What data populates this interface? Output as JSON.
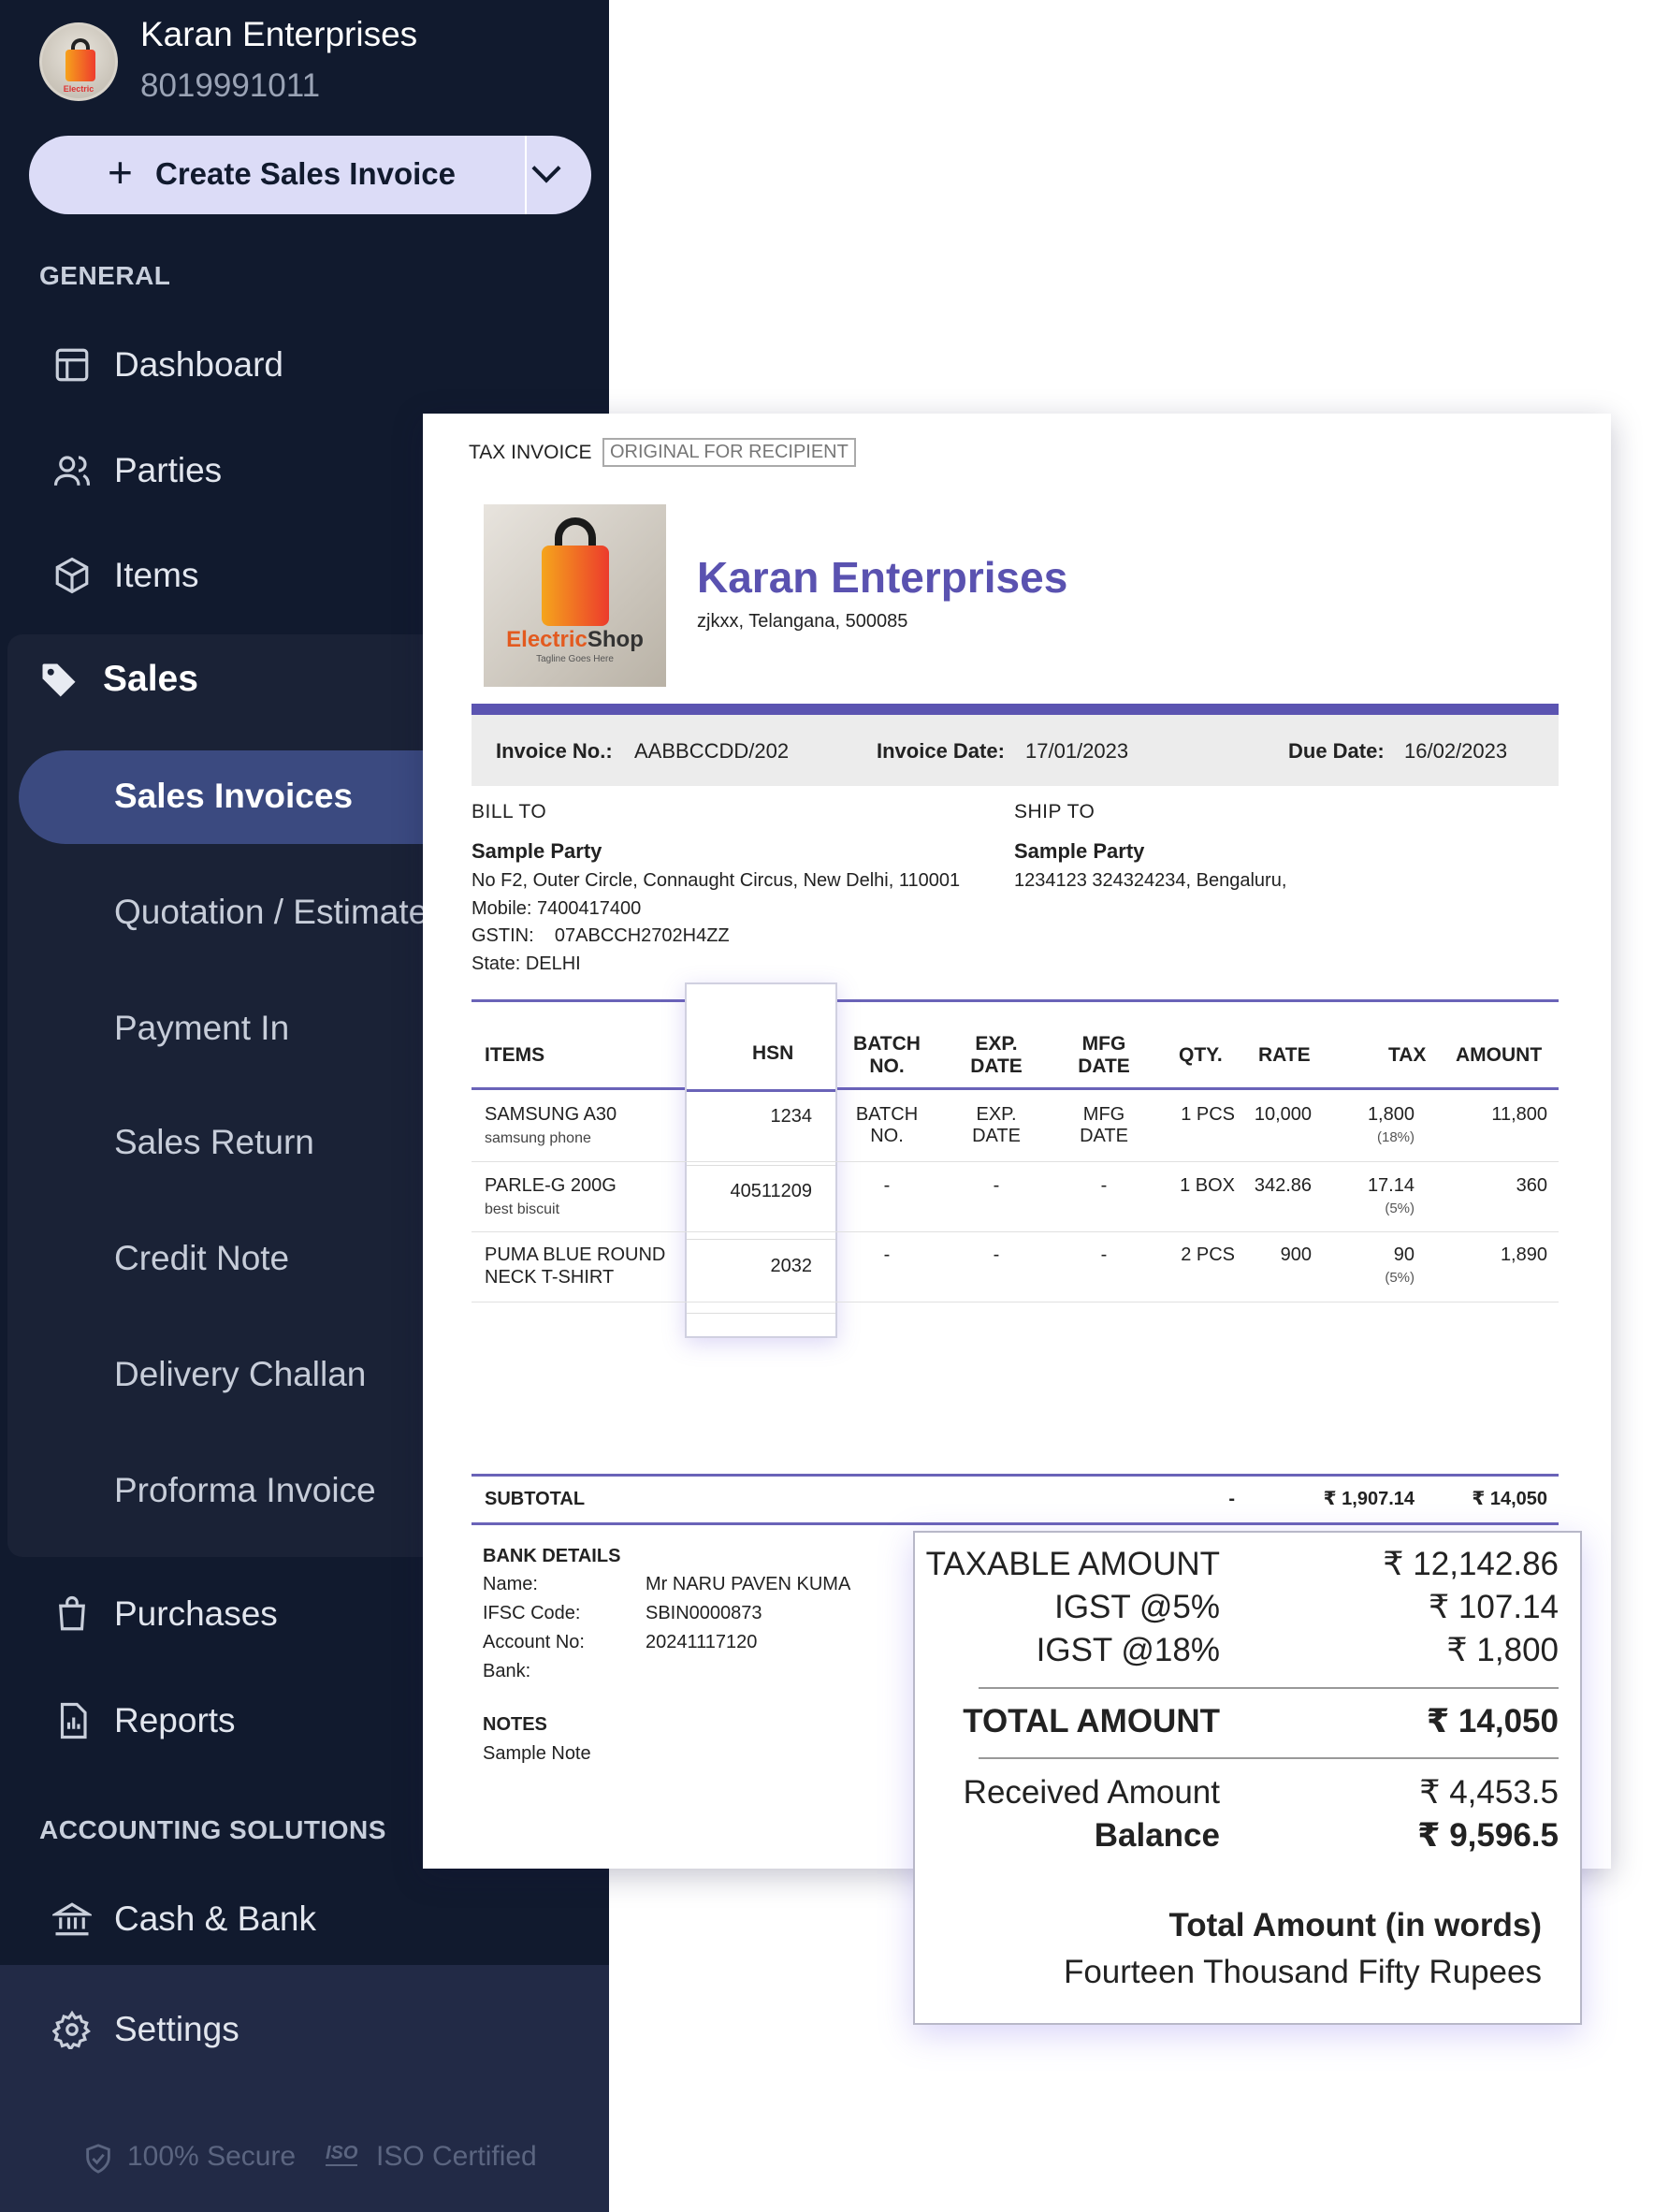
{
  "business": {
    "name": "Karan Enterprises",
    "phone": "8019991011"
  },
  "create_button": {
    "label": "Create Sales Invoice"
  },
  "sections": {
    "general": "GENERAL",
    "accounting": "ACCOUNTING SOLUTIONS"
  },
  "nav": {
    "dashboard": "Dashboard",
    "parties": "Parties",
    "items": "Items",
    "sales": "Sales",
    "purchases": "Purchases",
    "reports": "Reports",
    "cash_bank": "Cash & Bank",
    "settings": "Settings"
  },
  "sales_sub": {
    "invoices": "Sales Invoices",
    "quotation": "Quotation / Estimate",
    "payment_in": "Payment In",
    "sales_return": "Sales Return",
    "credit_note": "Credit Note",
    "delivery_challan": "Delivery Challan",
    "proforma": "Proforma Invoice"
  },
  "badges": {
    "secure": "100% Secure",
    "iso_glyph": "ISO",
    "iso": "ISO Certified"
  },
  "invoice": {
    "title": "TAX INVOICE",
    "copy": "ORIGINAL FOR RECIPIENT",
    "logo_word_1": "Electric",
    "logo_word_2": "Shop",
    "logo_tagline": "Tagline Goes Here",
    "company": "Karan Enterprises",
    "address": "zjkxx, Telangana, 500085",
    "meta": {
      "no_label": "Invoice No.:",
      "no": "AABBCCDD/202",
      "date_label": "Invoice Date:",
      "date": "17/01/2023",
      "due_label": "Due Date:",
      "due": "16/02/2023"
    },
    "bill_to": {
      "heading": "BILL TO",
      "name": "Sample Party",
      "address": "No F2, Outer Circle, Connaught Circus, New Delhi, 110001",
      "mobile": "Mobile:  7400417400",
      "gstin": "GSTIN:    07ABCCH2702H4ZZ",
      "state": "State:  DELHI"
    },
    "ship_to": {
      "heading": "SHIP TO",
      "name": "Sample Party",
      "address": "1234123 324324234, Bengaluru,"
    },
    "columns": {
      "items": "ITEMS",
      "hsn": "HSN",
      "batch_1": "BATCH",
      "batch_2": "NO.",
      "exp_1": "EXP.",
      "exp_2": "DATE",
      "mfg_1": "MFG",
      "mfg_2": "DATE",
      "qty": "QTY.",
      "rate": "RATE",
      "tax": "TAX",
      "amount": "AMOUNT"
    },
    "rows": [
      {
        "name": "SAMSUNG A30",
        "desc": "samsung phone",
        "hsn": "1234",
        "batch_1": "BATCH",
        "batch_2": "NO.",
        "exp_1": "EXP.",
        "exp_2": "DATE",
        "mfg_1": "MFG",
        "mfg_2": "DATE",
        "qty": "1 PCS",
        "rate": "10,000",
        "tax": "1,800",
        "tax_pct": "(18%)",
        "amount": "11,800"
      },
      {
        "name": "PARLE-G 200G",
        "desc": "best biscuit",
        "hsn": "40511209",
        "batch_1": "-",
        "exp_1": "-",
        "mfg_1": "-",
        "qty": "1 BOX",
        "rate": "342.86",
        "tax": "17.14",
        "tax_pct": "(5%)",
        "amount": "360"
      },
      {
        "name": "PUMA BLUE ROUND",
        "desc": "NECK T-SHIRT",
        "hsn": "2032",
        "batch_1": "-",
        "exp_1": "-",
        "mfg_1": "-",
        "qty": "2 PCS",
        "rate": "900",
        "tax": "90",
        "tax_pct": "(5%)",
        "amount": "1,890"
      }
    ],
    "subtotal": {
      "label": "SUBTOTAL",
      "qty": "-",
      "tax": "₹ 1,907.14",
      "amount": "₹ 14,050"
    },
    "bank": {
      "heading": "BANK DETAILS",
      "name_label": "Name:",
      "name": "Mr NARU PAVEN KUMA",
      "ifsc_label": "IFSC Code:",
      "ifsc": "SBIN0000873",
      "account_label": "Account No:",
      "account": "20241117120",
      "bank_label": "Bank:"
    },
    "notes": {
      "heading": "NOTES",
      "text": "Sample Note"
    }
  },
  "totals": {
    "taxable_label": "TAXABLE AMOUNT",
    "taxable": "₹ 12,142.86",
    "igst5_label": "IGST @5%",
    "igst5": "₹ 107.14",
    "igst18_label": "IGST @18%",
    "igst18": "₹ 1,800",
    "total_label": "TOTAL AMOUNT",
    "total": "₹ 14,050",
    "received_label": "Received Amount",
    "received": "₹ 4,453.5",
    "balance_label": "Balance",
    "balance": "₹ 9,596.5",
    "words_label": "Total Amount (in words)",
    "words": "Fourteen Thousand Fifty Rupees"
  },
  "colors": {
    "sidebar": "#111a2e",
    "accent": "#5a52b0",
    "active_pill": "#3b4a80",
    "button": "#dcdcf7"
  }
}
